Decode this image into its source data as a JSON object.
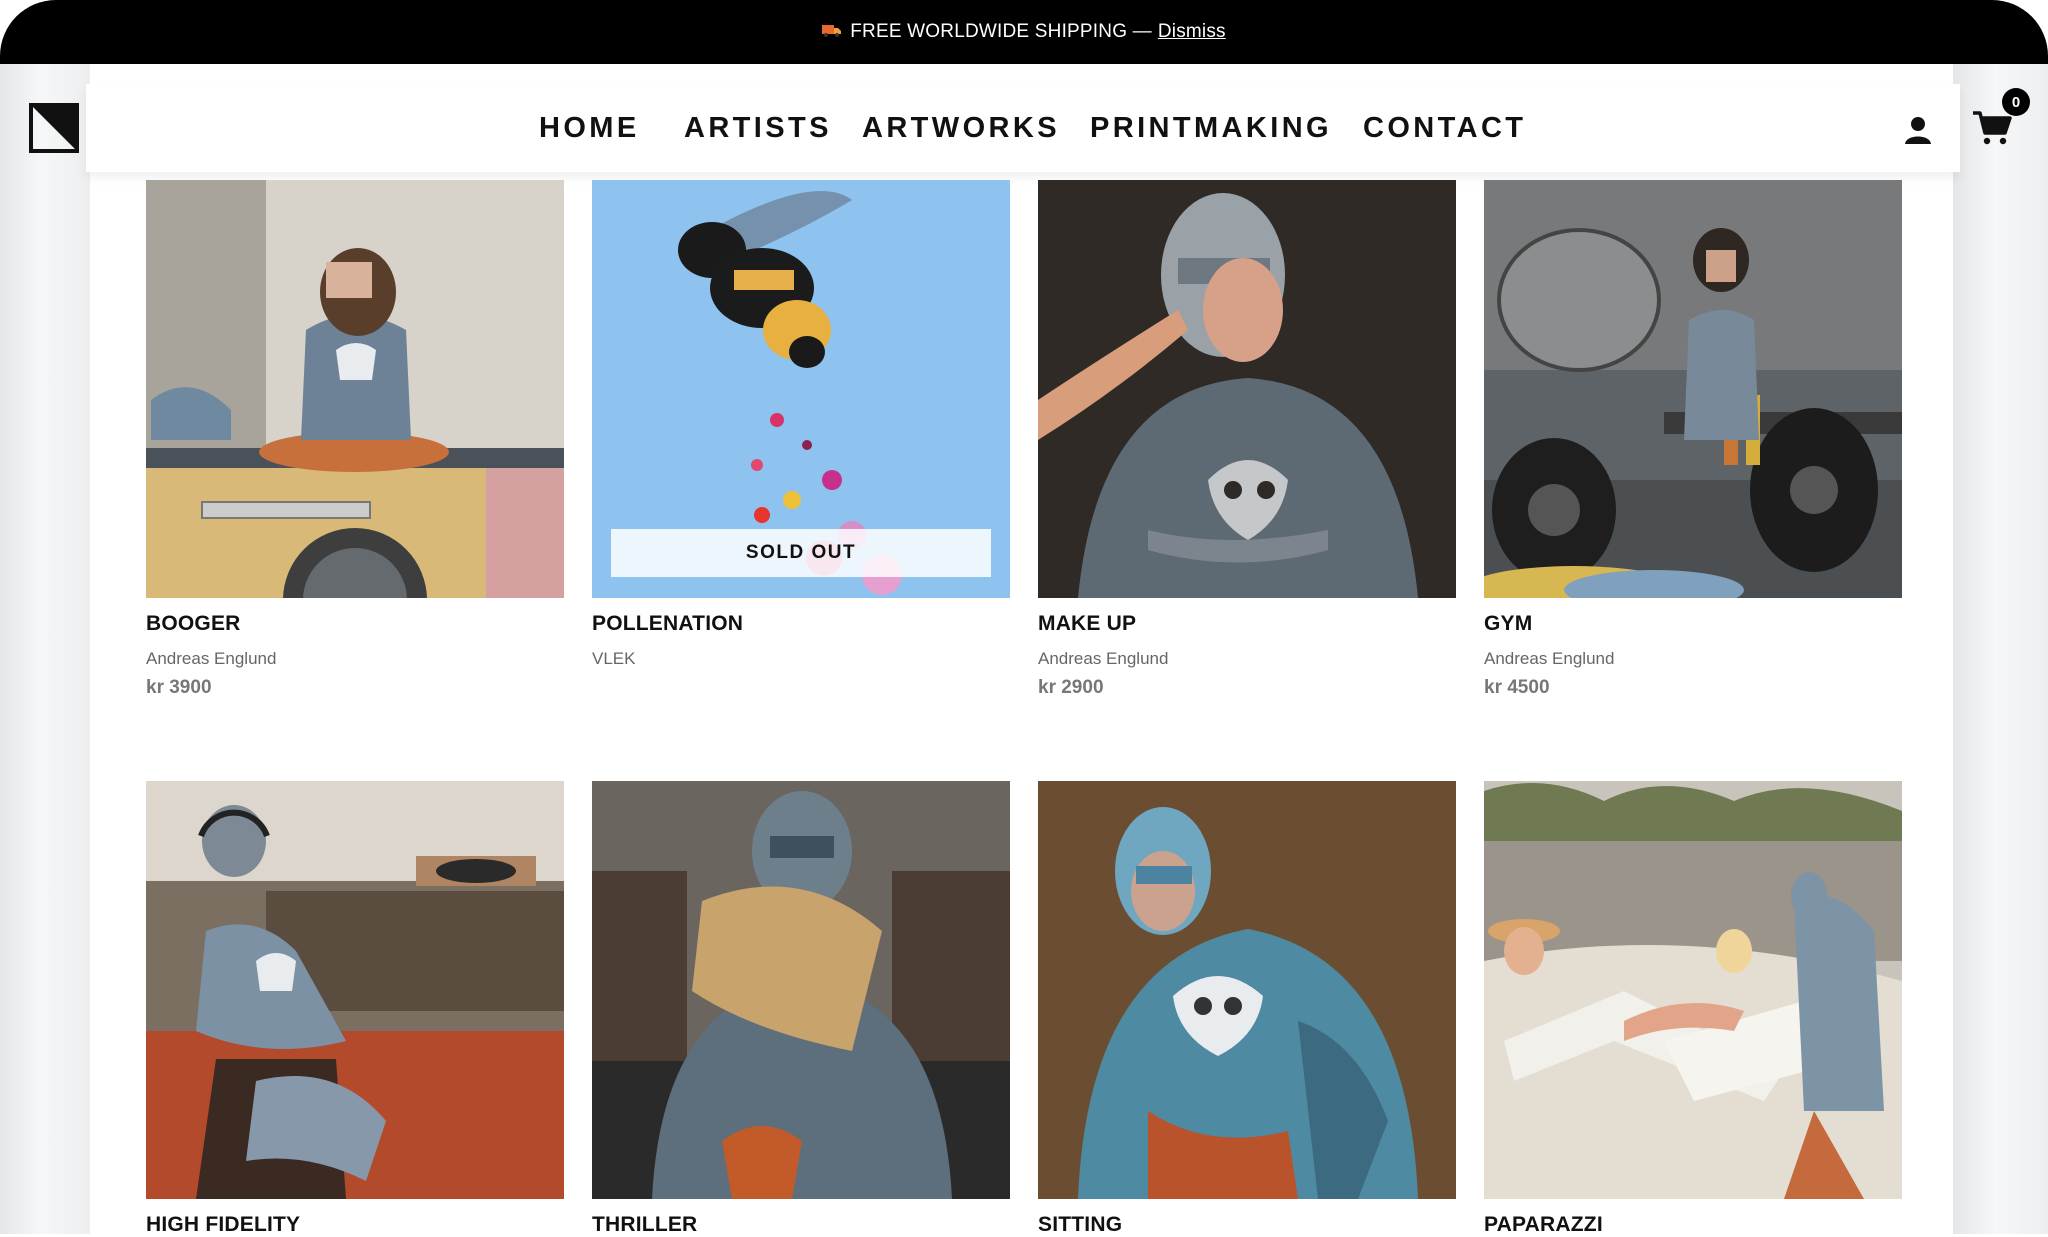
{
  "promo": {
    "truck_icon": "truck-icon",
    "text": "FREE WORLDWIDE SHIPPING —",
    "dismiss": "Dismiss"
  },
  "header": {
    "logo_icon": "gallery-logo-icon",
    "nav": [
      "HOME",
      "ARTISTS",
      "ARTWORKS",
      "PRINTMAKING",
      "CONTACT"
    ],
    "account_icon": "user-icon",
    "cart_icon": "cart-icon",
    "cart_count": "0"
  },
  "products": [
    {
      "title": "BOOGER",
      "artist": "Andreas Englund",
      "price": "kr 3900"
    },
    {
      "title": "POLLENATION",
      "artist": "VLEK",
      "badge": "SOLD OUT"
    },
    {
      "title": "MAKE UP",
      "artist": "Andreas Englund",
      "price": "kr 2900"
    },
    {
      "title": "GYM",
      "artist": "Andreas Englund",
      "price": "kr 4500"
    },
    {
      "title": "HIGH FIDELITY"
    },
    {
      "title": "THRILLER"
    },
    {
      "title": "SITTING"
    },
    {
      "title": "PAPARAZZI"
    }
  ],
  "colors": {
    "promo_bg": "#000000",
    "text": "#111111",
    "muted": "#666666",
    "price": "#777777"
  }
}
